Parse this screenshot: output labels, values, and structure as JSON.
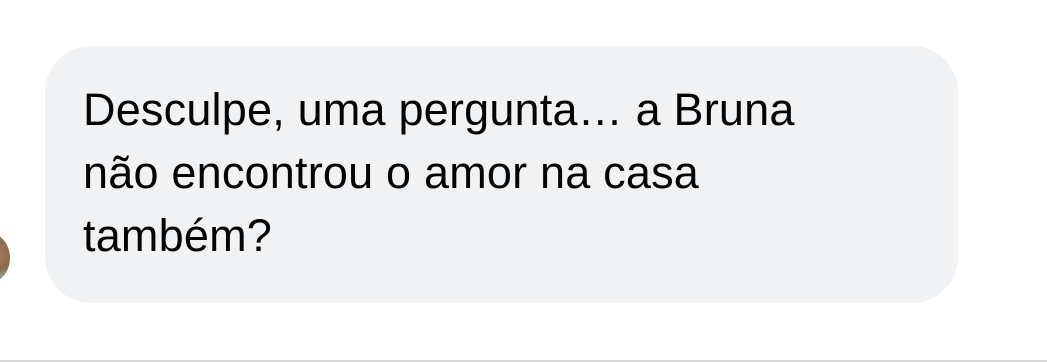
{
  "chat": {
    "message": {
      "text": "Desculpe, uma pergunta… a Bruna\nnão encontrou o amor na casa\ntambém?"
    }
  },
  "colors": {
    "bubble_background": "#f1f2f4",
    "text": "#050505",
    "page_background": "#ffffff"
  }
}
